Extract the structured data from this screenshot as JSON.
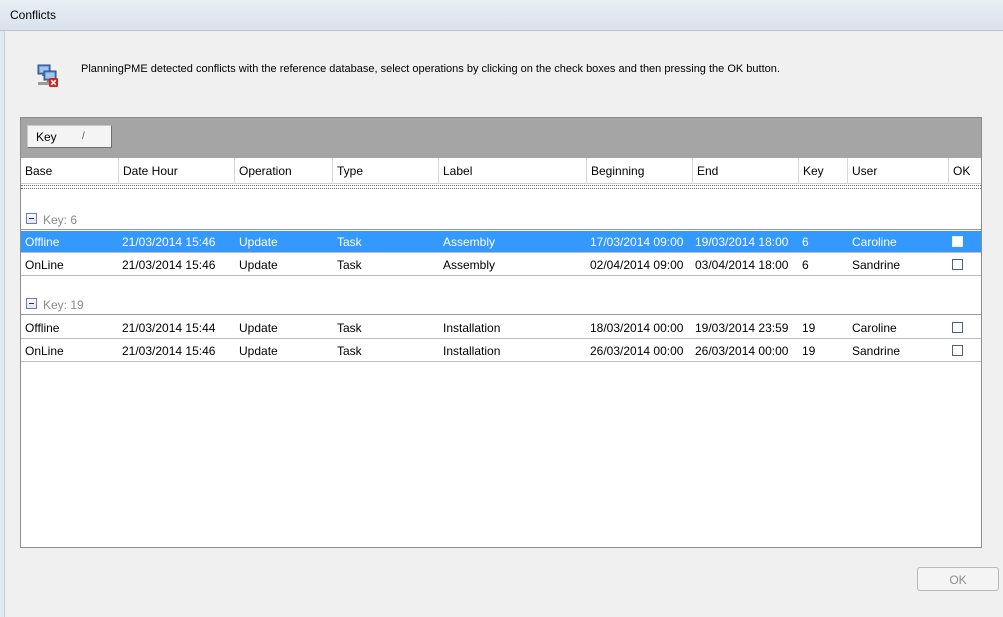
{
  "window": {
    "title": "Conflicts"
  },
  "message": {
    "icon": "computer-conflict-icon",
    "text": "PlanningPME detected conflicts with the reference database, select operations by clicking on the check boxes and then pressing the OK button."
  },
  "grid": {
    "group_by": {
      "label": "Key",
      "sort_indicator": "/"
    },
    "columns": [
      "Base",
      "Date Hour",
      "Operation",
      "Type",
      "Label",
      "Beginning",
      "End",
      "Key",
      "User",
      "OK"
    ],
    "groups": [
      {
        "label": "Key: 6",
        "rows": [
          {
            "base": "Offline",
            "date_hour": "21/03/2014 15:46",
            "operation": "Update",
            "type": "Task",
            "label": "Assembly",
            "beginning": "17/03/2014 09:00",
            "end": "19/03/2014 18:00",
            "key": "6",
            "user": "Caroline",
            "ok": false,
            "selected": true
          },
          {
            "base": "OnLine",
            "date_hour": "21/03/2014 15:46",
            "operation": "Update",
            "type": "Task",
            "label": "Assembly",
            "beginning": "02/04/2014 09:00",
            "end": "03/04/2014 18:00",
            "key": "6",
            "user": "Sandrine",
            "ok": false,
            "selected": false
          }
        ]
      },
      {
        "label": "Key: 19",
        "rows": [
          {
            "base": "Offline",
            "date_hour": "21/03/2014 15:44",
            "operation": "Update",
            "type": "Task",
            "label": "Installation",
            "beginning": "18/03/2014 00:00",
            "end": "19/03/2014 23:59",
            "key": "19",
            "user": "Caroline",
            "ok": false,
            "selected": false
          },
          {
            "base": "OnLine",
            "date_hour": "21/03/2014 15:46",
            "operation": "Update",
            "type": "Task",
            "label": "Installation",
            "beginning": "26/03/2014 00:00",
            "end": "26/03/2014 00:00",
            "key": "19",
            "user": "Sandrine",
            "ok": false,
            "selected": false
          }
        ]
      }
    ]
  },
  "buttons": {
    "ok_label": "OK",
    "ok_enabled": false
  },
  "colors": {
    "selection": "#3399ff",
    "group_bar": "#a5a5a5",
    "disabled_text": "#8d8d8d"
  }
}
